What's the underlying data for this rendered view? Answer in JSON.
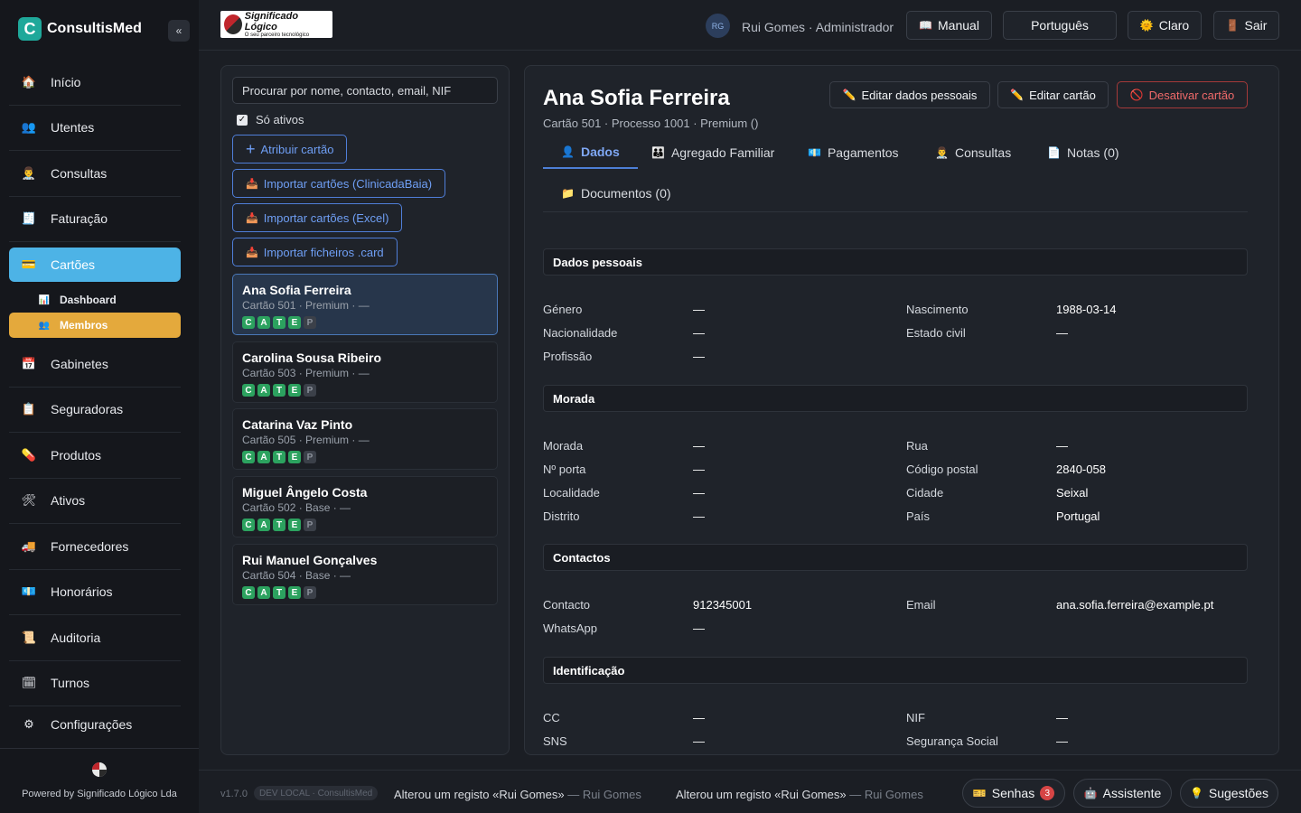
{
  "app": {
    "name": "ConsultisMed",
    "collapse_label": "«"
  },
  "sidebar": {
    "items": [
      {
        "label": "Início",
        "icon": "home-icon",
        "glyph": "🏠"
      },
      {
        "label": "Utentes",
        "icon": "users-icon",
        "glyph": "👥"
      },
      {
        "label": "Consultas",
        "icon": "doctor-icon",
        "glyph": "👨‍⚕️"
      },
      {
        "label": "Faturação",
        "icon": "invoice-icon",
        "glyph": "🧾"
      },
      {
        "label": "Cartões",
        "icon": "card-icon",
        "glyph": "💳"
      },
      {
        "label": "Gabinetes",
        "icon": "calendar-icon",
        "glyph": "📅"
      },
      {
        "label": "Seguradoras",
        "icon": "insurance-icon",
        "glyph": "📋"
      },
      {
        "label": "Produtos",
        "icon": "pill-icon",
        "glyph": "💊"
      },
      {
        "label": "Ativos",
        "icon": "tools-icon",
        "glyph": "🛠"
      },
      {
        "label": "Fornecedores",
        "icon": "truck-icon",
        "glyph": "🚚"
      },
      {
        "label": "Honorários",
        "icon": "money-icon",
        "glyph": "💶"
      },
      {
        "label": "Auditoria",
        "icon": "scroll-icon",
        "glyph": "📜"
      },
      {
        "label": "Turnos",
        "icon": "schedule-icon",
        "glyph": "🗓"
      },
      {
        "label": "Configurações",
        "icon": "gear-icon",
        "glyph": "⚙"
      }
    ],
    "subitems": [
      {
        "label": "Dashboard",
        "icon": "chart-icon",
        "glyph": "📊"
      },
      {
        "label": "Membros",
        "icon": "members-icon",
        "glyph": "👥"
      }
    ],
    "powered_by": "Powered by Significado Lógico Lda"
  },
  "topbar": {
    "company_logo_title": "Significado Lógico",
    "company_logo_sub": "O seu parceiro tecnológico",
    "user_initials": "RG",
    "user_label": "Rui Gomes · Administrador",
    "manual": "Manual",
    "language": "Português",
    "theme": "Claro",
    "logout": "Sair"
  },
  "list": {
    "search_placeholder": "Procurar por nome, contacto, email, NIF",
    "only_active_label": "Só ativos",
    "only_active_checked": true,
    "assign_card": "Atribuir cartão",
    "import_clinica": "Importar cartões (ClinicadaBaia)",
    "import_excel": "Importar cartões (Excel)",
    "import_card_files": "Importar ficheiros .card",
    "members": [
      {
        "name": "Ana Sofia Ferreira",
        "sub": "Cartão 501 · Premium · —",
        "selected": true,
        "badges": [
          "C",
          "A",
          "T",
          "E",
          "P"
        ]
      },
      {
        "name": "Carolina Sousa Ribeiro",
        "sub": "Cartão 503 · Premium · —",
        "selected": false,
        "badges": [
          "C",
          "A",
          "T",
          "E",
          "P"
        ]
      },
      {
        "name": "Catarina Vaz Pinto",
        "sub": "Cartão 505 · Premium · —",
        "selected": false,
        "badges": [
          "C",
          "A",
          "T",
          "E",
          "P"
        ]
      },
      {
        "name": "Miguel Ângelo Costa",
        "sub": "Cartão 502 · Base · —",
        "selected": false,
        "badges": [
          "C",
          "A",
          "T",
          "E",
          "P"
        ]
      },
      {
        "name": "Rui Manuel Gonçalves",
        "sub": "Cartão 504 · Base · —",
        "selected": false,
        "badges": [
          "C",
          "A",
          "T",
          "E",
          "P"
        ]
      }
    ]
  },
  "detail": {
    "name": "Ana Sofia Ferreira",
    "subtitle": "Cartão 501 · Processo 1001 · Premium ()",
    "edit_personal": "Editar dados pessoais",
    "edit_card": "Editar cartão",
    "deactivate_card": "Desativar cartão",
    "tabs": [
      {
        "label": "Dados",
        "icon": "person-icon",
        "glyph": "👤"
      },
      {
        "label": "Agregado Familiar",
        "icon": "family-icon",
        "glyph": "👪"
      },
      {
        "label": "Pagamentos",
        "icon": "money-icon",
        "glyph": "💶"
      },
      {
        "label": "Consultas",
        "icon": "doctor-icon",
        "glyph": "👨‍⚕️"
      },
      {
        "label": "Notas (0)",
        "icon": "note-icon",
        "glyph": "📄"
      },
      {
        "label": "Documentos (0)",
        "icon": "folder-icon",
        "glyph": "📁"
      }
    ],
    "sections": {
      "personal": {
        "title": "Dados pessoais",
        "genero_label": "Género",
        "genero": "—",
        "nascimento_label": "Nascimento",
        "nascimento": "1988-03-14",
        "nacionalidade_label": "Nacionalidade",
        "nacionalidade": "—",
        "estado_civil_label": "Estado civil",
        "estado_civil": "—",
        "profissao_label": "Profissão",
        "profissao": "—"
      },
      "address": {
        "title": "Morada",
        "morada_label": "Morada",
        "morada": "—",
        "rua_label": "Rua",
        "rua": "—",
        "porta_label": "Nº porta",
        "porta": "—",
        "codigo_postal_label": "Código postal",
        "codigo_postal": "2840-058",
        "localidade_label": "Localidade",
        "localidade": "—",
        "cidade_label": "Cidade",
        "cidade": "Seixal",
        "distrito_label": "Distrito",
        "distrito": "—",
        "pais_label": "País",
        "pais": "Portugal"
      },
      "contacts": {
        "title": "Contactos",
        "contacto_label": "Contacto",
        "contacto": "912345001",
        "email_label": "Email",
        "email": "ana.sofia.ferreira@example.pt",
        "whatsapp_label": "WhatsApp",
        "whatsapp": "—"
      },
      "identification": {
        "title": "Identificação",
        "cc_label": "CC",
        "cc": "—",
        "nif_label": "NIF",
        "nif": "—",
        "sns_label": "SNS",
        "sns": "—",
        "ss_label": "Segurança Social",
        "ss": "—"
      }
    }
  },
  "bottom": {
    "version": "v1.7.0",
    "env": "DEV LOCAL · ConsultisMed",
    "log1_text": "Alterou um registo «Rui Gomes»",
    "log1_who": " — Rui Gomes",
    "log2_text": "Alterou um registo «Rui Gomes»",
    "log2_who": " — Rui Gomes",
    "senhas": "Senhas",
    "senhas_count": "3",
    "assistente": "Assistente",
    "sugestoes": "Sugestões"
  }
}
